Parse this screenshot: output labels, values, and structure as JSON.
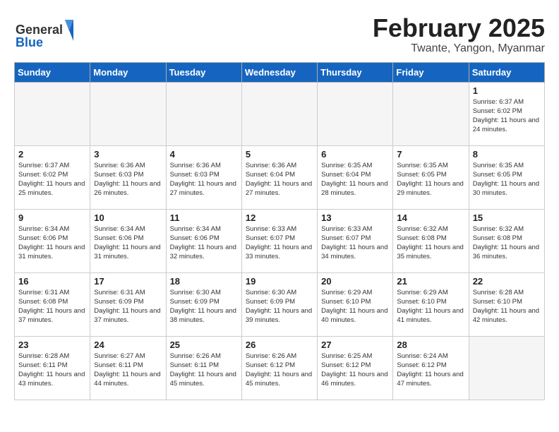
{
  "header": {
    "logo_general": "General",
    "logo_blue": "Blue",
    "month_title": "February 2025",
    "location": "Twante, Yangon, Myanmar"
  },
  "weekdays": [
    "Sunday",
    "Monday",
    "Tuesday",
    "Wednesday",
    "Thursday",
    "Friday",
    "Saturday"
  ],
  "weeks": [
    [
      {
        "day": "",
        "info": ""
      },
      {
        "day": "",
        "info": ""
      },
      {
        "day": "",
        "info": ""
      },
      {
        "day": "",
        "info": ""
      },
      {
        "day": "",
        "info": ""
      },
      {
        "day": "",
        "info": ""
      },
      {
        "day": "1",
        "info": "Sunrise: 6:37 AM\nSunset: 6:02 PM\nDaylight: 11 hours and 24 minutes."
      }
    ],
    [
      {
        "day": "2",
        "info": "Sunrise: 6:37 AM\nSunset: 6:02 PM\nDaylight: 11 hours and 25 minutes."
      },
      {
        "day": "3",
        "info": "Sunrise: 6:36 AM\nSunset: 6:03 PM\nDaylight: 11 hours and 26 minutes."
      },
      {
        "day": "4",
        "info": "Sunrise: 6:36 AM\nSunset: 6:03 PM\nDaylight: 11 hours and 27 minutes."
      },
      {
        "day": "5",
        "info": "Sunrise: 6:36 AM\nSunset: 6:04 PM\nDaylight: 11 hours and 27 minutes."
      },
      {
        "day": "6",
        "info": "Sunrise: 6:35 AM\nSunset: 6:04 PM\nDaylight: 11 hours and 28 minutes."
      },
      {
        "day": "7",
        "info": "Sunrise: 6:35 AM\nSunset: 6:05 PM\nDaylight: 11 hours and 29 minutes."
      },
      {
        "day": "8",
        "info": "Sunrise: 6:35 AM\nSunset: 6:05 PM\nDaylight: 11 hours and 30 minutes."
      }
    ],
    [
      {
        "day": "9",
        "info": "Sunrise: 6:34 AM\nSunset: 6:06 PM\nDaylight: 11 hours and 31 minutes."
      },
      {
        "day": "10",
        "info": "Sunrise: 6:34 AM\nSunset: 6:06 PM\nDaylight: 11 hours and 31 minutes."
      },
      {
        "day": "11",
        "info": "Sunrise: 6:34 AM\nSunset: 6:06 PM\nDaylight: 11 hours and 32 minutes."
      },
      {
        "day": "12",
        "info": "Sunrise: 6:33 AM\nSunset: 6:07 PM\nDaylight: 11 hours and 33 minutes."
      },
      {
        "day": "13",
        "info": "Sunrise: 6:33 AM\nSunset: 6:07 PM\nDaylight: 11 hours and 34 minutes."
      },
      {
        "day": "14",
        "info": "Sunrise: 6:32 AM\nSunset: 6:08 PM\nDaylight: 11 hours and 35 minutes."
      },
      {
        "day": "15",
        "info": "Sunrise: 6:32 AM\nSunset: 6:08 PM\nDaylight: 11 hours and 36 minutes."
      }
    ],
    [
      {
        "day": "16",
        "info": "Sunrise: 6:31 AM\nSunset: 6:08 PM\nDaylight: 11 hours and 37 minutes."
      },
      {
        "day": "17",
        "info": "Sunrise: 6:31 AM\nSunset: 6:09 PM\nDaylight: 11 hours and 37 minutes."
      },
      {
        "day": "18",
        "info": "Sunrise: 6:30 AM\nSunset: 6:09 PM\nDaylight: 11 hours and 38 minutes."
      },
      {
        "day": "19",
        "info": "Sunrise: 6:30 AM\nSunset: 6:09 PM\nDaylight: 11 hours and 39 minutes."
      },
      {
        "day": "20",
        "info": "Sunrise: 6:29 AM\nSunset: 6:10 PM\nDaylight: 11 hours and 40 minutes."
      },
      {
        "day": "21",
        "info": "Sunrise: 6:29 AM\nSunset: 6:10 PM\nDaylight: 11 hours and 41 minutes."
      },
      {
        "day": "22",
        "info": "Sunrise: 6:28 AM\nSunset: 6:10 PM\nDaylight: 11 hours and 42 minutes."
      }
    ],
    [
      {
        "day": "23",
        "info": "Sunrise: 6:28 AM\nSunset: 6:11 PM\nDaylight: 11 hours and 43 minutes."
      },
      {
        "day": "24",
        "info": "Sunrise: 6:27 AM\nSunset: 6:11 PM\nDaylight: 11 hours and 44 minutes."
      },
      {
        "day": "25",
        "info": "Sunrise: 6:26 AM\nSunset: 6:11 PM\nDaylight: 11 hours and 45 minutes."
      },
      {
        "day": "26",
        "info": "Sunrise: 6:26 AM\nSunset: 6:12 PM\nDaylight: 11 hours and 45 minutes."
      },
      {
        "day": "27",
        "info": "Sunrise: 6:25 AM\nSunset: 6:12 PM\nDaylight: 11 hours and 46 minutes."
      },
      {
        "day": "28",
        "info": "Sunrise: 6:24 AM\nSunset: 6:12 PM\nDaylight: 11 hours and 47 minutes."
      },
      {
        "day": "",
        "info": ""
      }
    ]
  ]
}
